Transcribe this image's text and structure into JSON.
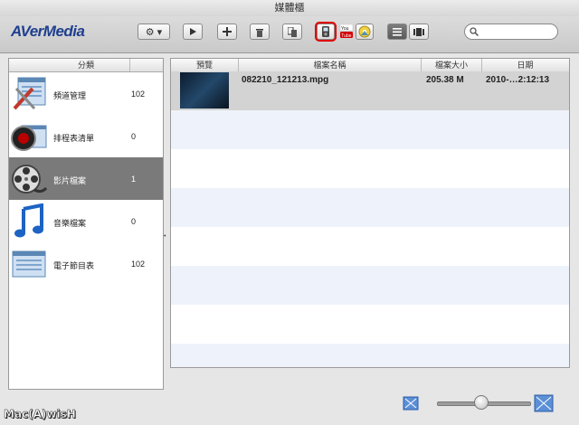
{
  "window": {
    "title": "媒體櫃"
  },
  "brand": {
    "logo_text": "AVerMedia"
  },
  "toolbar": {
    "buttons": [
      {
        "name": "settings",
        "icon": "gear-icon",
        "label": "⚙ ▾"
      },
      {
        "name": "play",
        "icon": "play-icon"
      },
      {
        "name": "add",
        "icon": "plus-icon"
      },
      {
        "name": "delete",
        "icon": "trash-icon"
      },
      {
        "name": "copy",
        "icon": "copy-icon"
      },
      {
        "name": "ipod-export",
        "icon": "ipod-icon",
        "highlighted": true
      },
      {
        "name": "youtube",
        "icon": "youtube-icon",
        "label": "You Tube"
      },
      {
        "name": "burn",
        "icon": "disc-icon"
      },
      {
        "name": "list-view",
        "icon": "list-view-icon",
        "selected": true
      },
      {
        "name": "filmstrip-view",
        "icon": "filmstrip-icon"
      }
    ],
    "search_placeholder": ""
  },
  "sidebar": {
    "header": "分類",
    "items": [
      {
        "label": "頻道管理",
        "count": "102",
        "icon": "channel-manager-icon"
      },
      {
        "label": "排程表清單",
        "count": "0",
        "icon": "schedule-icon"
      },
      {
        "label": "影片檔案",
        "count": "1",
        "icon": "film-reel-icon",
        "selected": true
      },
      {
        "label": "音樂檔案",
        "count": "0",
        "icon": "music-note-icon"
      },
      {
        "label": "電子節目表",
        "count": "102",
        "icon": "epg-icon"
      }
    ]
  },
  "table": {
    "columns": [
      "預覽",
      "檔案名稱",
      "檔案大小",
      "日期"
    ],
    "rows": [
      {
        "preview": "video-thumbnail",
        "filename": "082210_121213.mpg",
        "size": "205.38 M",
        "date": "2010-…2:12:13"
      }
    ]
  },
  "footer": {
    "zoom_level": 0.45,
    "watermark": "Mac(A)wisH"
  },
  "colors": {
    "accent_logo": "#1f3f8f",
    "selected_sidebar": "#7a7a7a",
    "highlight": "#e00000",
    "alt_row": "#eef3fb"
  }
}
